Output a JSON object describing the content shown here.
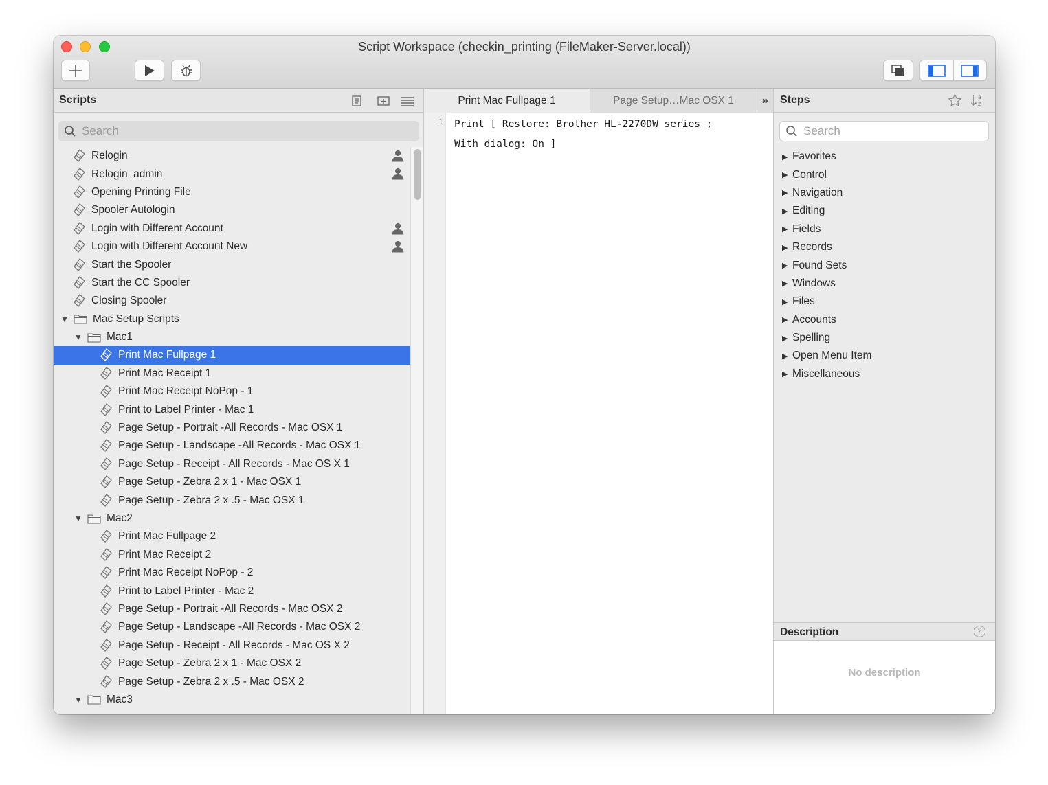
{
  "window": {
    "title": "Script Workspace (checkin_printing (FileMaker-Server.local))"
  },
  "scripts": {
    "header": "Scripts",
    "search_placeholder": "Search",
    "items": {
      "relogin": "Relogin",
      "relogin_admin": "Relogin_admin",
      "opening_printing_file": "Opening Printing File",
      "spooler_autologin": "Spooler Autologin",
      "login_different": "Login with Different Account",
      "login_different_new": "Login with Different Account New",
      "start_spooler": "Start the Spooler",
      "start_cc_spooler": "Start the CC Spooler",
      "closing_spooler": "Closing Spooler",
      "mac_setup_folder": "Mac Setup Scripts",
      "mac1_folder": "Mac1",
      "mac1": [
        "Print Mac Fullpage 1",
        "Print Mac Receipt 1",
        "Print Mac Receipt NoPop - 1",
        "Print to Label Printer - Mac 1",
        "Page Setup - Portrait -All Records - Mac OSX 1",
        "Page Setup - Landscape -All Records - Mac OSX 1",
        "Page Setup - Receipt - All Records - Mac OS X 1",
        "Page Setup  - Zebra 2 x 1 - Mac OSX 1",
        "Page Setup  - Zebra 2 x .5 - Mac OSX 1"
      ],
      "mac2_folder": "Mac2",
      "mac2": [
        "Print Mac Fullpage 2",
        "Print Mac Receipt 2",
        "Print Mac Receipt NoPop - 2",
        "Print to Label Printer - Mac 2",
        "Page Setup - Portrait -All Records - Mac OSX 2",
        "Page Setup - Landscape -All Records - Mac OSX 2",
        "Page Setup - Receipt - All Records - Mac OS X 2",
        "Page Setup  - Zebra 2 x 1 - Mac OSX 2",
        "Page Setup  - Zebra 2 x .5 - Mac OSX 2"
      ],
      "mac3_folder": "Mac3"
    }
  },
  "editor": {
    "tabs": [
      "Print Mac Fullpage 1",
      "Page Setup…Mac OSX 1"
    ],
    "more_tabs": "»",
    "line_number": "1",
    "code_line1": "Print [ Restore: Brother HL-2270DW series ;",
    "code_line2": "With dialog: On ]"
  },
  "steps": {
    "header": "Steps",
    "search_placeholder": "Search",
    "categories": [
      "Favorites",
      "Control",
      "Navigation",
      "Editing",
      "Fields",
      "Records",
      "Found Sets",
      "Windows",
      "Files",
      "Accounts",
      "Spelling",
      "Open Menu Item",
      "Miscellaneous"
    ]
  },
  "description": {
    "header": "Description",
    "help": "?",
    "empty_text": "No description"
  },
  "colors": {
    "selection": "#3a74e6",
    "accent": "#1b6ae8"
  }
}
